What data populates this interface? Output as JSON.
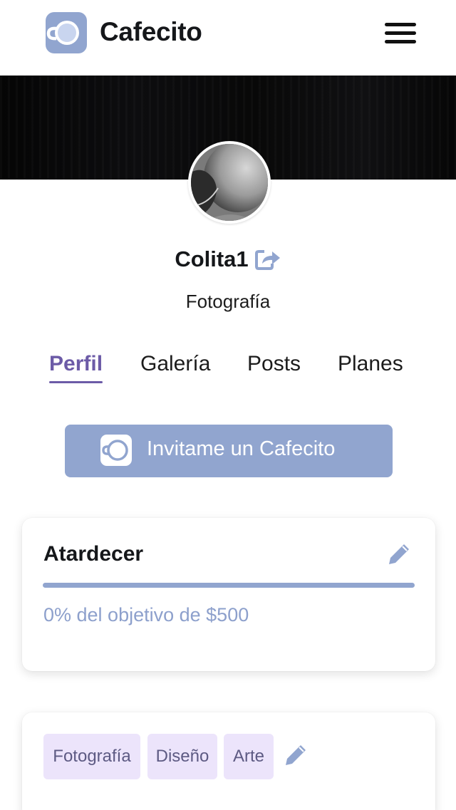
{
  "header": {
    "brand": "Cafecito",
    "logo_icon": "cafecito-cup-icon",
    "menu_icon": "hamburger-menu-icon"
  },
  "profile": {
    "name": "Colita1",
    "share_icon": "share-external-icon",
    "category": "Fotografía"
  },
  "tabs": [
    {
      "label": "Perfil",
      "active": true
    },
    {
      "label": "Galería",
      "active": false
    },
    {
      "label": "Posts",
      "active": false
    },
    {
      "label": "Planes",
      "active": false
    }
  ],
  "cta": {
    "label": "Invitame un Cafecito",
    "icon": "cafecito-cup-icon"
  },
  "goal": {
    "title": "Atardecer",
    "progress_percent": 0,
    "text": "0% del objetivo de $500",
    "edit_icon": "pencil-icon"
  },
  "tags": {
    "items": [
      "Fotografía",
      "Diseño",
      "Arte"
    ],
    "edit_icon": "pencil-icon"
  },
  "colors": {
    "accent": "#6c5ba7",
    "button": "#91a5cf",
    "tag_bg": "#ece4fb",
    "tag_text": "#5d5a83",
    "goal_text": "#8da0cc"
  }
}
